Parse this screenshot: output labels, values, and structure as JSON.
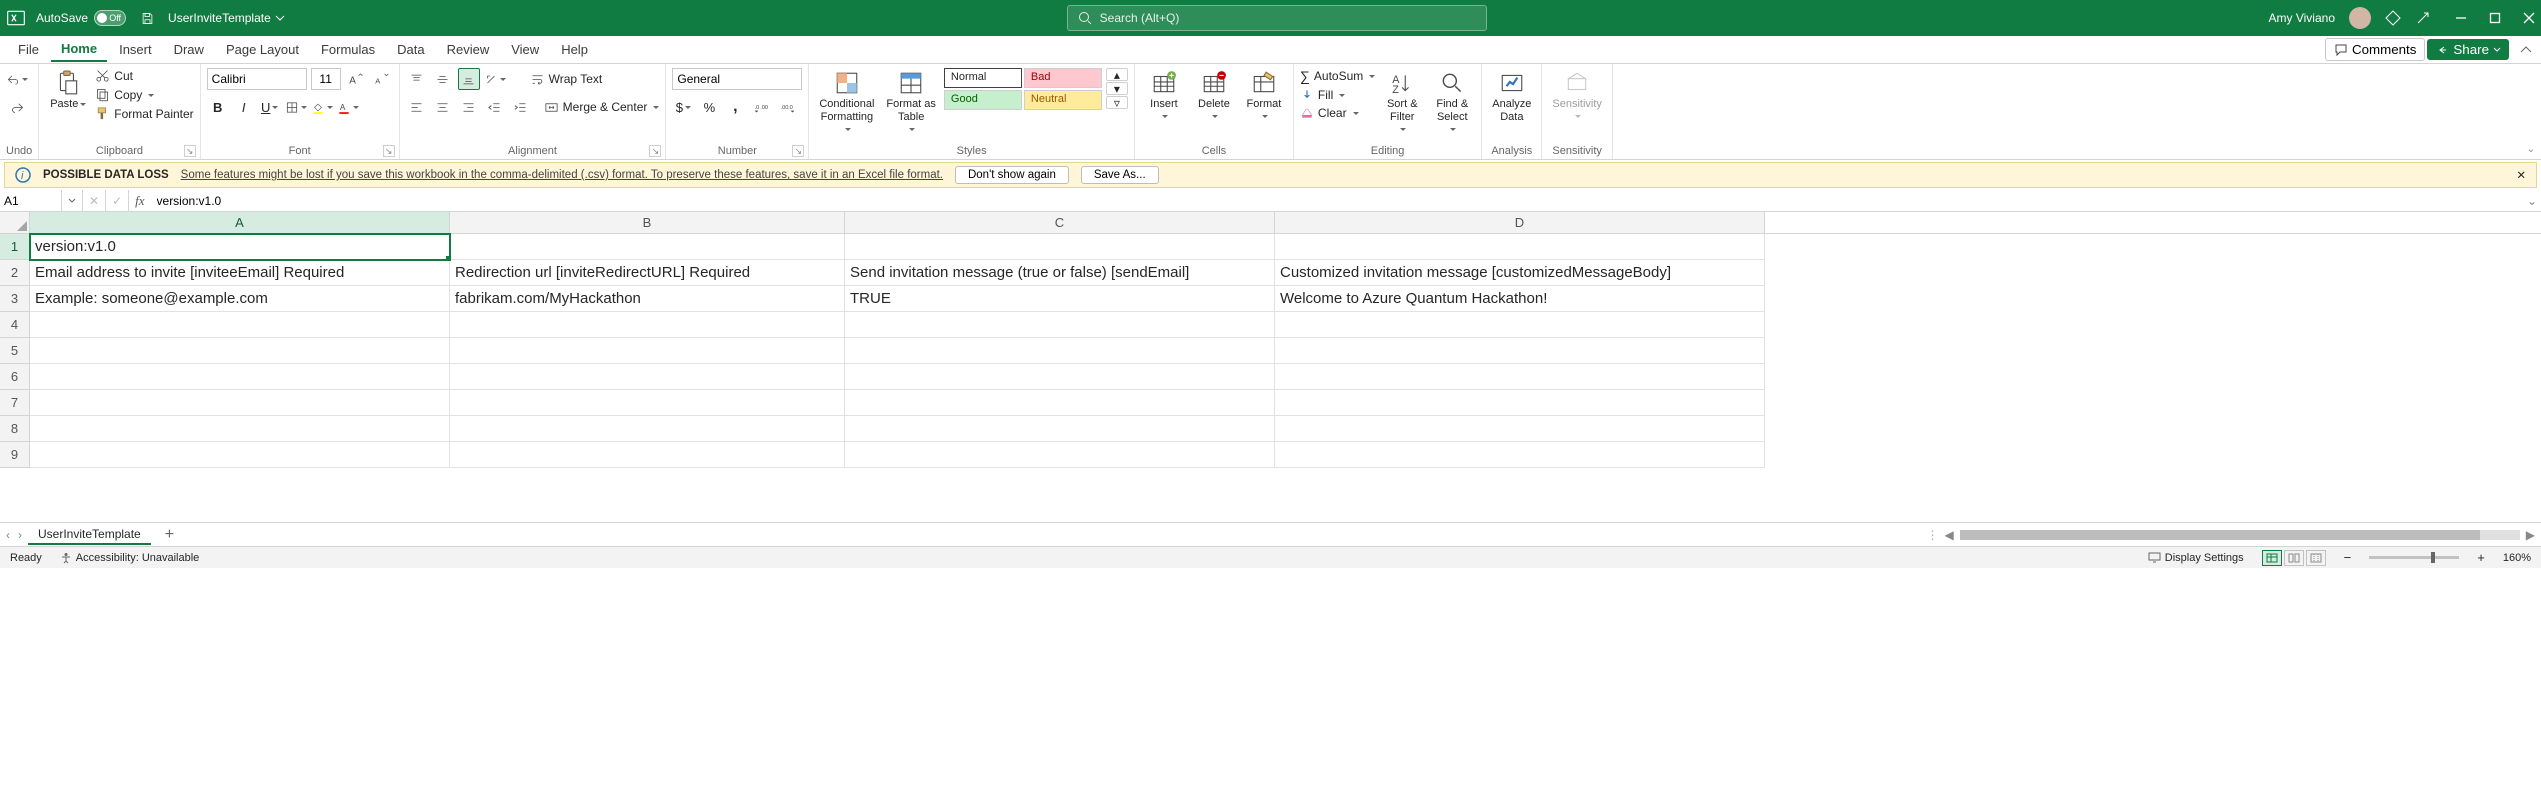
{
  "title_bar": {
    "autosave_label": "AutoSave",
    "autosave_state": "Off",
    "document_name": "UserInviteTemplate",
    "search_placeholder": "Search (Alt+Q)",
    "user_name": "Amy Viviano"
  },
  "tabs": {
    "file": "File",
    "home": "Home",
    "insert": "Insert",
    "draw": "Draw",
    "page_layout": "Page Layout",
    "formulas": "Formulas",
    "data": "Data",
    "review": "Review",
    "view": "View",
    "help": "Help",
    "comments": "Comments",
    "share": "Share"
  },
  "ribbon": {
    "undo": "Undo",
    "paste": "Paste",
    "cut": "Cut",
    "copy": "Copy",
    "format_painter": "Format Painter",
    "clipboard": "Clipboard",
    "font_name": "Calibri",
    "font_size": "11",
    "font": "Font",
    "wrap_text": "Wrap Text",
    "merge_center": "Merge & Center",
    "alignment": "Alignment",
    "number_format": "General",
    "number": "Number",
    "conditional_formatting": "Conditional\nFormatting",
    "format_as_table": "Format as\nTable",
    "style_normal": "Normal",
    "style_bad": "Bad",
    "style_good": "Good",
    "style_neutral": "Neutral",
    "styles": "Styles",
    "insert": "Insert",
    "delete": "Delete",
    "format": "Format",
    "cells": "Cells",
    "autosum": "AutoSum",
    "fill": "Fill",
    "clear": "Clear",
    "sort_filter": "Sort &\nFilter",
    "find_select": "Find &\nSelect",
    "editing": "Editing",
    "analyze_data": "Analyze\nData",
    "analysis": "Analysis",
    "sensitivity": "Sensitivity",
    "sensitivity_group": "Sensitivity"
  },
  "warning": {
    "title": "POSSIBLE DATA LOSS",
    "message": "Some features might be lost if you save this workbook in the comma-delimited (.csv) format. To preserve these features, save it in an Excel file format.",
    "dont_show": "Don't show again",
    "save_as": "Save As..."
  },
  "namebox": {
    "ref": "A1",
    "formula": "version:v1.0"
  },
  "columns": [
    "A",
    "B",
    "C",
    "D"
  ],
  "rows": [
    "1",
    "2",
    "3",
    "4",
    "5",
    "6",
    "7",
    "8",
    "9"
  ],
  "cells": {
    "A1": "version:v1.0",
    "A2": "Email address to invite [inviteeEmail] Required",
    "B2": "Redirection url [inviteRedirectURL] Required",
    "C2": "Send invitation message (true or false) [sendEmail]",
    "D2": "Customized invitation message [customizedMessageBody]",
    "A3": "Example:    someone@example.com",
    "B3": "fabrikam.com/MyHackathon",
    "C3": "TRUE",
    "D3": " Welcome to Azure Quantum Hackathon!"
  },
  "sheet": {
    "tab": "UserInviteTemplate"
  },
  "status": {
    "ready": "Ready",
    "accessibility": "Accessibility: Unavailable",
    "display_settings": "Display Settings",
    "zoom": "160%"
  }
}
